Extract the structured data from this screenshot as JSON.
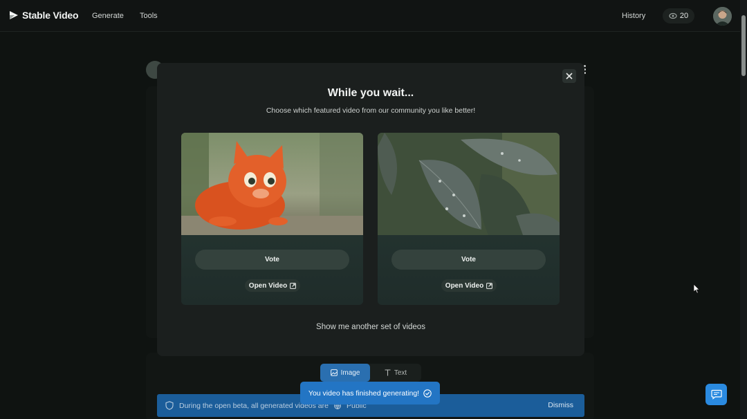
{
  "nav": {
    "brand": "Stable Video",
    "links": [
      "Generate",
      "Tools"
    ],
    "history": "History",
    "credits": "20"
  },
  "modal": {
    "title": "While you wait...",
    "subtitle": "Choose which featured video from our community you like better!",
    "cards": [
      {
        "vote_label": "Vote",
        "open_label": "Open Video",
        "thumb": "cartoon-orange-cat"
      },
      {
        "vote_label": "Vote",
        "open_label": "Open Video",
        "thumb": "leaves-with-dew"
      }
    ],
    "another": "Show me another set of videos"
  },
  "tabs": [
    {
      "label": "Image",
      "icon": "image-icon",
      "active": true
    },
    {
      "label": "Text",
      "icon": "text-icon",
      "active": false
    }
  ],
  "toast": {
    "text": "You video has finished generating!"
  },
  "beta": {
    "text": "During the open beta, all generated videos are",
    "visibility": "Public",
    "dismiss": "Dismiss"
  },
  "colors": {
    "accent": "#2375c4",
    "background": "#0f1311",
    "modal": "#1b1f1e"
  }
}
